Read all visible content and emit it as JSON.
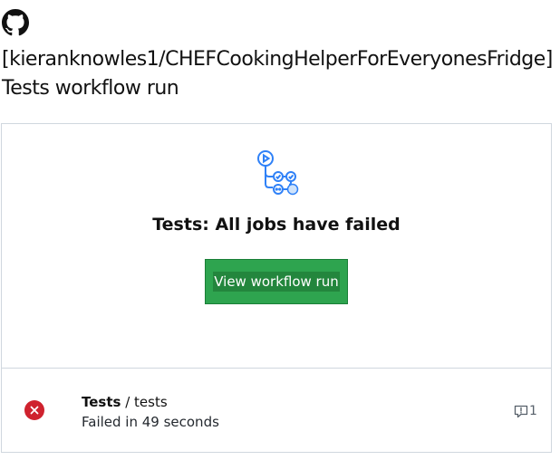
{
  "header": {
    "repo": "[kieranknowles1/CHEFCookingHelperForEveryonesFridge]",
    "subtitle": "Tests workflow run"
  },
  "card": {
    "headline": "Tests: All jobs have failed",
    "button_label": "View workflow run"
  },
  "job": {
    "workflow": "Tests",
    "separator": " / ",
    "name": "tests",
    "status": "Failed in 49 seconds",
    "annotation_count": "1"
  },
  "icons": {
    "logo": "github-mark-icon",
    "workflow": "actions-workflow-icon",
    "failure": "x-circle-fill-icon",
    "annotation": "comment-alert-icon"
  },
  "colors": {
    "button": "#2ea44f",
    "failure": "#cf222e",
    "workflow_icon": "#2f81f7"
  }
}
